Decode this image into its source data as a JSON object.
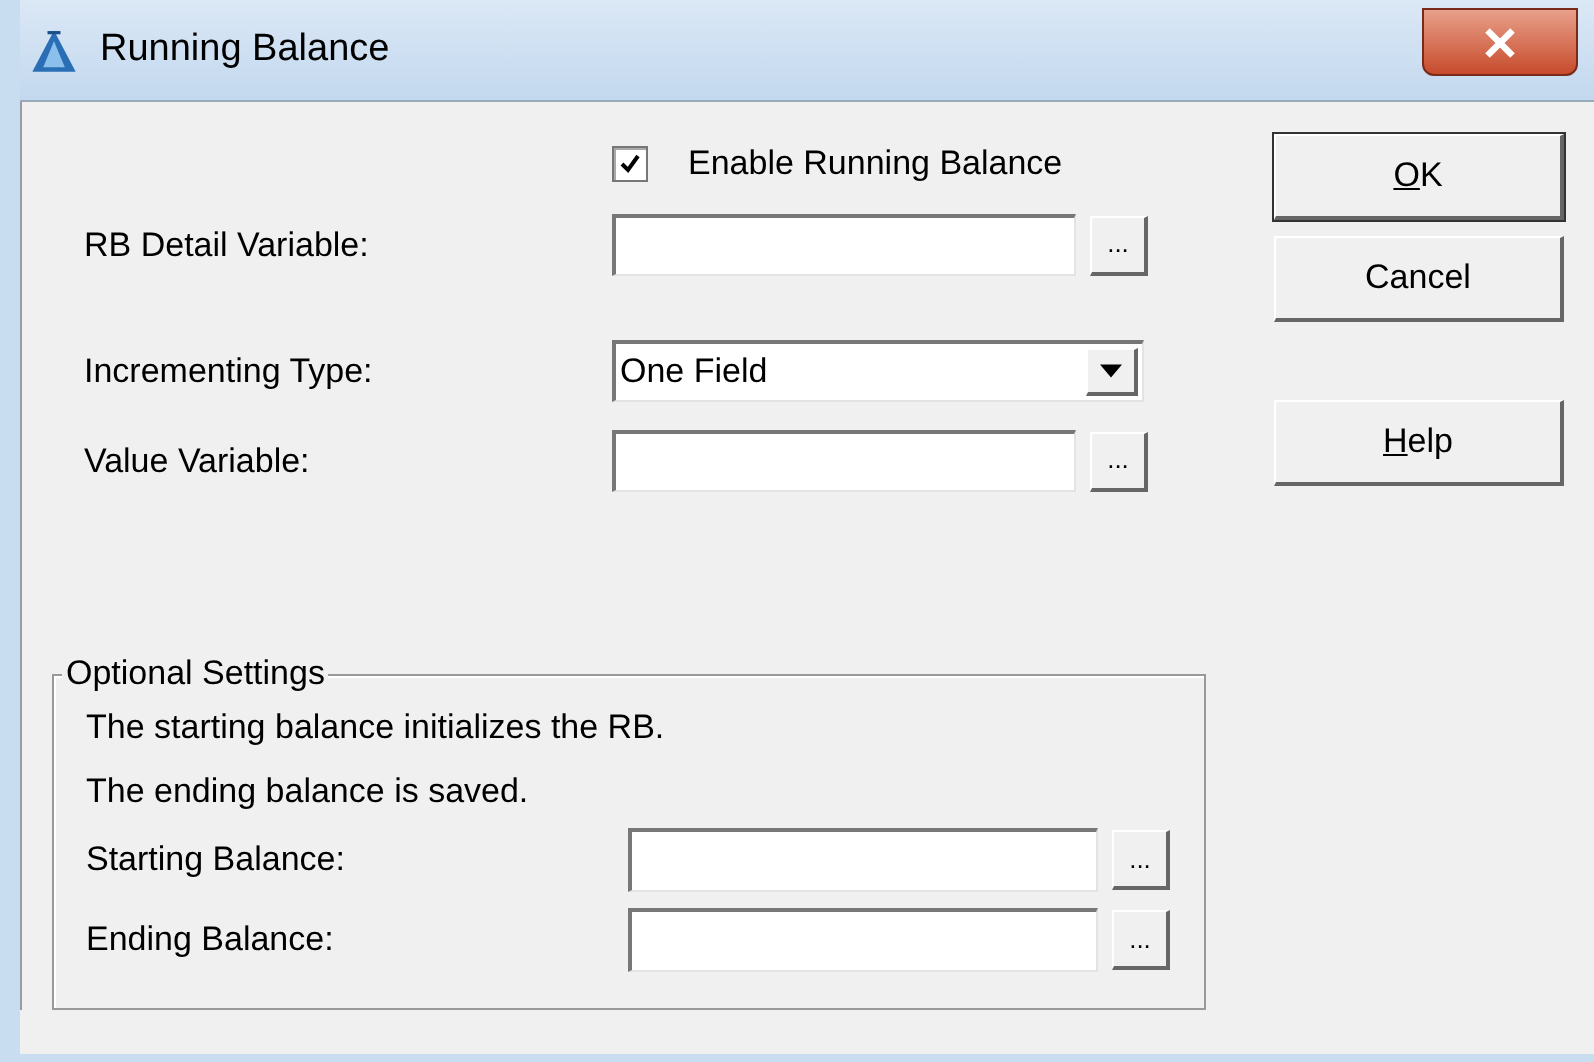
{
  "window": {
    "title": "Running Balance"
  },
  "enable_checkbox": {
    "label": "Enable Running Balance",
    "checked": true
  },
  "fields": [
    {
      "kind": "browse",
      "label": "RB Detail Variable:"
    },
    {
      "kind": "dropdown",
      "label": "Incrementing Type:",
      "value": "One Field"
    },
    {
      "kind": "browse",
      "label": "Value Variable:"
    }
  ],
  "optional_settings": {
    "title": "Optional Settings",
    "notes": [
      "The starting balance initializes the RB.",
      "The ending balance is saved."
    ],
    "fields": [
      {
        "kind": "browse",
        "label": "Starting Balance:"
      },
      {
        "kind": "browse",
        "label": "Ending Balance:"
      }
    ]
  },
  "browse_button_label": "...",
  "buttons": [
    {
      "label": "OK",
      "mnemonic": true,
      "default": true
    },
    {
      "label": "Cancel",
      "mnemonic": false,
      "default": false
    },
    {
      "label": "Help",
      "mnemonic": true,
      "default": false
    }
  ]
}
